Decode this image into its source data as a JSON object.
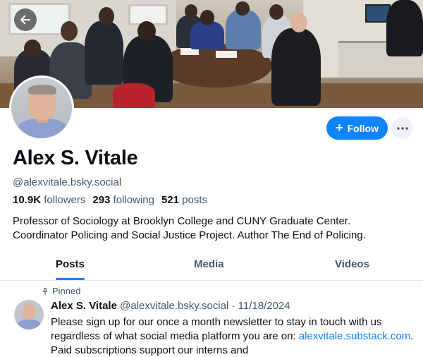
{
  "profile": {
    "display_name": "Alex S. Vitale",
    "handle": "@alexvitale.bsky.social",
    "followers_count": "10.9K",
    "followers_label": "followers",
    "following_count": "293",
    "following_label": "following",
    "posts_count": "521",
    "posts_label": "posts",
    "bio_line1": "Professor of Sociology at Brooklyn College and CUNY Graduate Center.",
    "bio_line2": "Coordinator Policing and Social Justice Project. Author The End of Policing."
  },
  "actions": {
    "follow_label": "Follow",
    "follow_icon": "plus-icon",
    "more_icon": "ellipsis-icon",
    "back_icon": "arrow-left-icon"
  },
  "tabs": [
    {
      "label": "Posts",
      "active": true
    },
    {
      "label": "Media",
      "active": false
    },
    {
      "label": "Videos",
      "active": false
    }
  ],
  "pinned_post": {
    "pinned_label": "Pinned",
    "author_name": "Alex S. Vitale",
    "author_handle": "@alexvitale.bsky.social",
    "separator": "·",
    "date": "11/18/2024",
    "text_part1": "Please sign up for our once a month newsletter to stay in touch with us regardless of what social media platform you are on: ",
    "link_text": "alexvitale.substack.com",
    "text_part2": ". Paid subscriptions support our interns and"
  },
  "colors": {
    "accent": "#1083fe",
    "muted_text": "#42576c",
    "primary_text": "#0b0f14"
  }
}
